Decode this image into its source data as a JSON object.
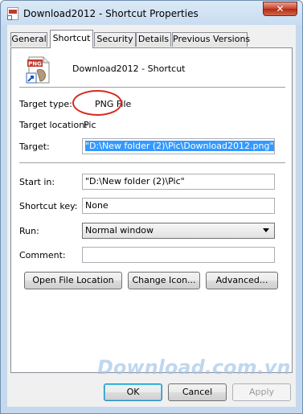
{
  "window": {
    "title": "Download2012 - Shortcut Properties",
    "close_glyph": "✕"
  },
  "tabs": [
    "General",
    "Shortcut",
    "Security",
    "Details",
    "Previous Versions"
  ],
  "active_tab": "Shortcut",
  "header": {
    "icon_badge": "PNG",
    "file_name": "Download2012 - Shortcut"
  },
  "fields": {
    "target_type_label": "Target type:",
    "target_type_value": "PNG File",
    "target_location_label": "Target location:",
    "target_location_value": "Pic",
    "target_label": "Target:",
    "target_value": "\"D:\\New folder (2)\\Pic\\Download2012.png\"",
    "start_in_label": "Start in:",
    "start_in_value": "\"D:\\New folder (2)\\Pic\"",
    "shortcut_key_label": "Shortcut key:",
    "shortcut_key_value": "None",
    "run_label": "Run:",
    "run_value": "Normal window",
    "comment_label": "Comment:",
    "comment_value": ""
  },
  "buttons": {
    "open_file_location": "Open File Location",
    "change_icon": "Change Icon...",
    "advanced": "Advanced...",
    "ok": "OK",
    "cancel": "Cancel",
    "apply": "Apply"
  },
  "watermark": "Download.com.vn",
  "colors": {
    "selection": "#3399ff",
    "annotation_circle": "#d8281e",
    "close_button": "#c8412c"
  }
}
